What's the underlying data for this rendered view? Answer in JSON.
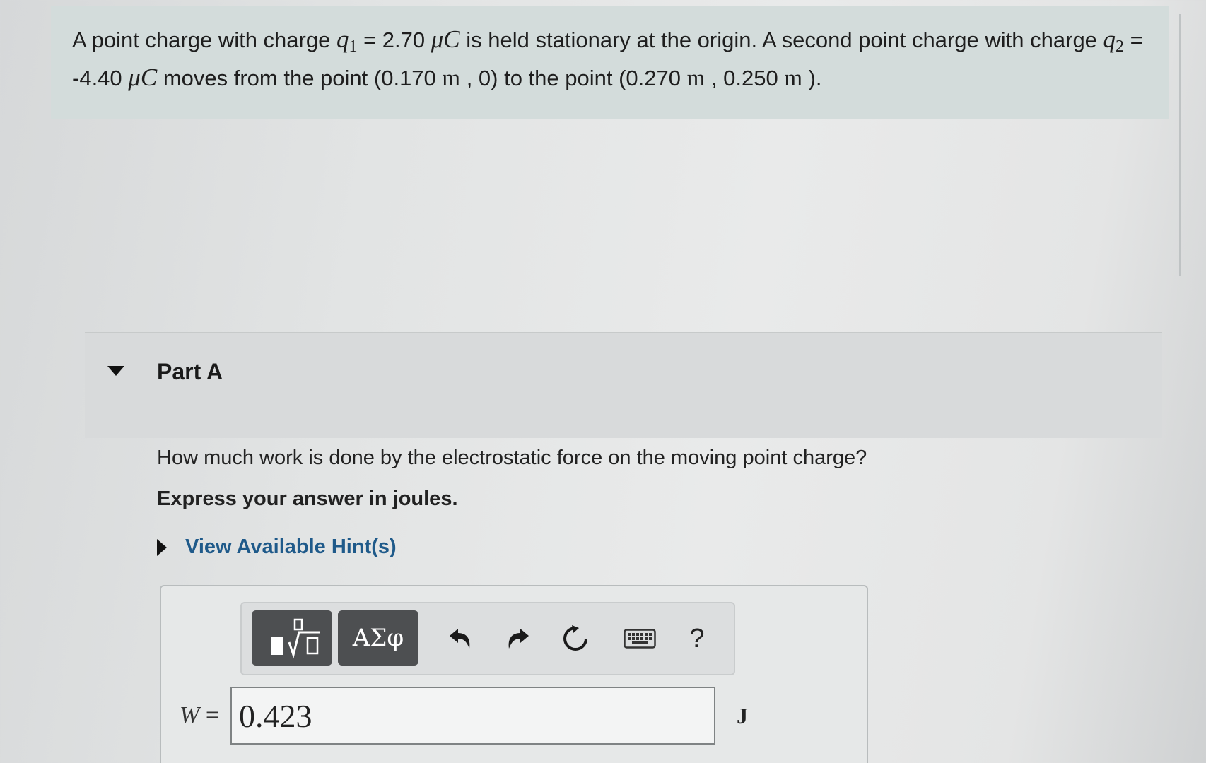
{
  "problem": {
    "text_1": "A point charge with charge ",
    "q1_symbol": "q",
    "q1_sub": "1",
    "text_2": " = 2.70 ",
    "unit_1": "μC",
    "text_3": " is held stationary at the origin. A second point charge with charge ",
    "q2_symbol": "q",
    "q2_sub": "2",
    "text_4": " = -4.40 ",
    "unit_2": "μC",
    "text_5": " moves from the point (0.170 ",
    "m_1": "m",
    "text_6": " , 0) to the point (0.270 ",
    "m_2": "m",
    "text_7": " , 0.250 ",
    "m_3": "m",
    "text_8": " )."
  },
  "part": {
    "title": "Part A"
  },
  "question": "How much work is done by the electrostatic force on the moving point charge?",
  "instruction": "Express your answer in joules.",
  "hint_label": "View Available Hint(s)",
  "toolbar": {
    "greek_label": "ΑΣφ",
    "help_label": "?"
  },
  "answer": {
    "var": "W",
    "equals": " =",
    "value": "0.423",
    "unit": "J"
  },
  "icons": [
    "templates-icon",
    "greek-letters-icon",
    "undo-icon",
    "redo-icon",
    "reset-icon",
    "keyboard-icon",
    "help-icon",
    "expand-caret-icon"
  ]
}
